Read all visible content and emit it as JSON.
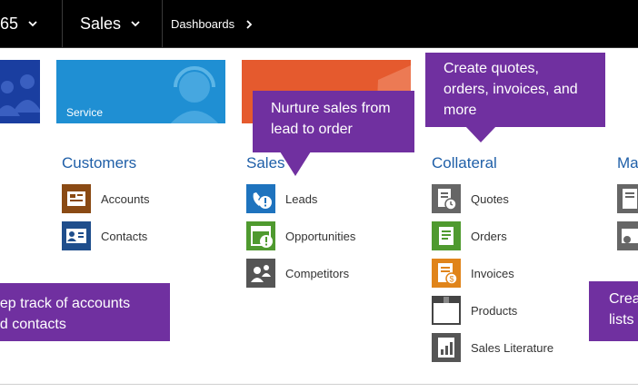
{
  "nav": {
    "app_fragment": "65",
    "module": "Sales",
    "area": "Dashboards"
  },
  "tiles": {
    "service_label": "Service"
  },
  "columns": {
    "customers": {
      "heading": "Customers",
      "items": [
        {
          "label": "Accounts",
          "icon": "accounts-icon"
        },
        {
          "label": "Contacts",
          "icon": "contacts-icon"
        }
      ]
    },
    "sales": {
      "heading": "Sales",
      "items": [
        {
          "label": "Leads",
          "icon": "leads-icon"
        },
        {
          "label": "Opportunities",
          "icon": "opportunities-icon"
        },
        {
          "label": "Competitors",
          "icon": "competitors-icon"
        }
      ]
    },
    "collateral": {
      "heading": "Collateral",
      "items": [
        {
          "label": "Quotes",
          "icon": "quotes-icon"
        },
        {
          "label": "Orders",
          "icon": "orders-icon"
        },
        {
          "label": "Invoices",
          "icon": "invoices-icon"
        },
        {
          "label": "Products",
          "icon": "products-icon"
        },
        {
          "label": "Sales Literature",
          "icon": "sales-literature-icon"
        }
      ]
    },
    "marketing": {
      "heading": "Ma"
    }
  },
  "callouts": {
    "nurture": {
      "line1": "Nurture sales from",
      "line2": "lead to order"
    },
    "collateral": {
      "line1": "Create quotes,",
      "line2": "orders, invoices, and",
      "line3": "more"
    },
    "customers": {
      "line1": "eep track of accounts",
      "line2": "nd contacts"
    },
    "marketing": {
      "line1": "Crea",
      "line2": "lists"
    }
  },
  "colors": {
    "callout": "#7030a0",
    "heading": "#1f5fa8",
    "service_tile": "#1f8fd3",
    "orange_tile": "#e55a2e",
    "blue_tile": "#1a3ea0"
  }
}
